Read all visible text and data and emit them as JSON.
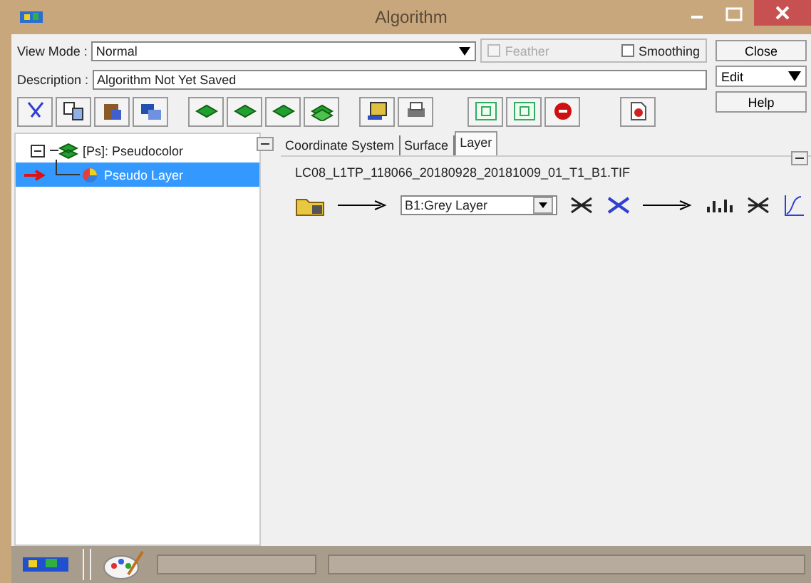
{
  "window": {
    "title": "Algorithm"
  },
  "view_mode": {
    "label": "View Mode :",
    "value": "Normal"
  },
  "options": [
    {
      "label": "Feather",
      "checked": false,
      "disabled": true
    },
    {
      "label": "Smoothing",
      "checked": false,
      "disabled": false
    }
  ],
  "description": {
    "label": "Description :",
    "value": "Algorithm Not Yet Saved"
  },
  "side_buttons": [
    {
      "label": "Close",
      "kind": "button"
    },
    {
      "label": "Edit",
      "kind": "menu"
    },
    {
      "label": "Help",
      "kind": "button"
    }
  ],
  "tree": [
    {
      "label": "[Ps]: Pseudocolor",
      "expanded": true,
      "selected": false,
      "children": [
        {
          "label": "Pseudo Layer",
          "selected": true
        }
      ]
    }
  ],
  "tabs": [
    {
      "label": "Coordinate System",
      "selected": false
    },
    {
      "label": "Surface",
      "selected": false
    },
    {
      "label": "Layer",
      "selected": true
    }
  ],
  "file_name": "LC08_L1TP_118066_20180928_20181009_01_T1_B1.TIF",
  "layer_select": {
    "value": "B1:Grey Layer"
  }
}
